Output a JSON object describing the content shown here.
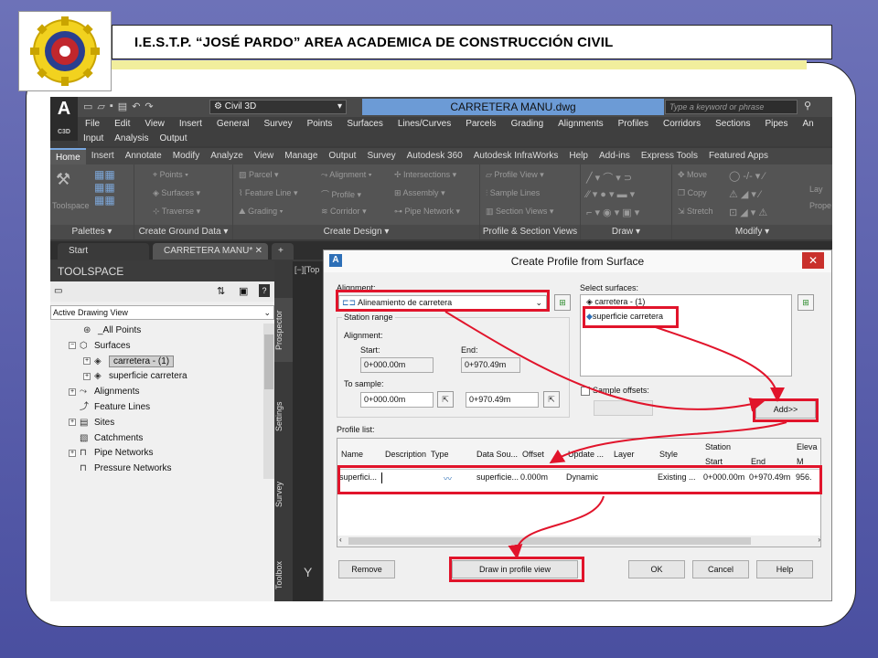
{
  "slide": {
    "title": "I.E.S.T.P. “JOSÉ PARDO” AREA ACADEMICA DE CONSTRUCCIÓN CIVIL"
  },
  "app": {
    "logo_letter": "A",
    "logo_sub": "C3D",
    "workspace": "Civil 3D",
    "doc_title": "CARRETERA MANU.dwg",
    "search_placeholder": "Type a keyword or phrase"
  },
  "menu": [
    "File",
    "Edit",
    "View",
    "Insert",
    "General",
    "Survey",
    "Points",
    "Surfaces",
    "Lines/Curves",
    "Parcels",
    "Grading",
    "Alignments",
    "Profiles",
    "Corridors",
    "Sections",
    "Pipes",
    "An"
  ],
  "menu2": [
    "Input",
    "Analysis",
    "Output"
  ],
  "ribbon_tabs": [
    "Home",
    "Insert",
    "Annotate",
    "Modify",
    "Analyze",
    "View",
    "Manage",
    "Output",
    "Survey",
    "Autodesk 360",
    "Autodesk InfraWorks",
    "Help",
    "Add-ins",
    "Express Tools",
    "Featured Apps"
  ],
  "ribbon": {
    "tools": {
      "toolspace": "Toolspace",
      "points": "Points",
      "surfaces": "Surfaces",
      "traverse": "Traverse",
      "parcel": "Parcel",
      "feature_line": "Feature Line",
      "grading": "Grading",
      "alignment": "Alignment",
      "profile": "Profile",
      "corridor": "Corridor",
      "intersections": "Intersections",
      "assembly": "Assembly",
      "pipe_network": "Pipe Network",
      "profile_view": "Profile View",
      "sample_lines": "Sample Lines",
      "section_views": "Section Views",
      "move": "Move",
      "copy": "Copy",
      "stretch": "Stretch",
      "layer": "Lay",
      "properties": "Prope"
    },
    "groups": [
      "Palettes",
      "Create Ground Data",
      "Create Design",
      "Profile & Section Views",
      "Draw",
      "Modify"
    ]
  },
  "doc_tabs": [
    "Start",
    "CARRETERA MANU*",
    "+"
  ],
  "toolspace": {
    "title": "TOOLSPACE",
    "view": "Active Drawing View",
    "tree": [
      {
        "label": "_All Points",
        "indent": 2
      },
      {
        "label": "Surfaces",
        "indent": 1
      },
      {
        "label": "carretera - (1)",
        "indent": 2,
        "selected": true
      },
      {
        "label": "superficie carretera",
        "indent": 2
      },
      {
        "label": "Alignments",
        "indent": 1
      },
      {
        "label": "Feature Lines",
        "indent": 1
      },
      {
        "label": "Sites",
        "indent": 1
      },
      {
        "label": "Catchments",
        "indent": 1
      },
      {
        "label": "Pipe Networks",
        "indent": 1
      },
      {
        "label": "Pressure Networks",
        "indent": 1
      }
    ],
    "side_tabs": [
      "Prospector",
      "Settings",
      "Survey",
      "Toolbox"
    ]
  },
  "drawing": {
    "viewport_label": "[−][Top",
    "axis_label": "Y"
  },
  "dialog": {
    "title": "Create Profile from Surface",
    "alignment_label": "Alignment:",
    "alignment_value": "Alineamiento de carretera",
    "station_range_label": "Station range",
    "alignment_sub": "Alignment:",
    "start_label": "Start:",
    "end_label": "End:",
    "start_value": "0+000.00m",
    "end_value": "0+970.49m",
    "to_sample_label": "To sample:",
    "sample_start": "0+000.00m",
    "sample_end": "0+970.49m",
    "select_surfaces_label": "Select surfaces:",
    "surfaces": [
      "carretera - (1)",
      "superficie carretera"
    ],
    "sample_offsets_label": "Sample offsets:",
    "add_button": "Add>>",
    "profile_list_label": "Profile list:",
    "columns": [
      "Name",
      "Description",
      "Type",
      "Data Sou...",
      "Offset",
      "Update ...",
      "Layer",
      "Style",
      "Station",
      "Start",
      "End",
      "Eleva",
      "M"
    ],
    "row": {
      "name": "superfici...",
      "description": "",
      "data_source": "superficie...",
      "offset": "0.000m",
      "update": "Dynamic",
      "layer": "",
      "style": "Existing ...",
      "start": "0+000.00m",
      "end": "0+970.49m",
      "elev": "956."
    },
    "buttons": {
      "remove": "Remove",
      "draw": "Draw in profile view",
      "ok": "OK",
      "cancel": "Cancel",
      "help": "Help"
    }
  },
  "colors": {
    "highlight": "#e1142b",
    "accent_blue": "#6c9bd6",
    "yellow_strip": "#f1ee9d"
  }
}
